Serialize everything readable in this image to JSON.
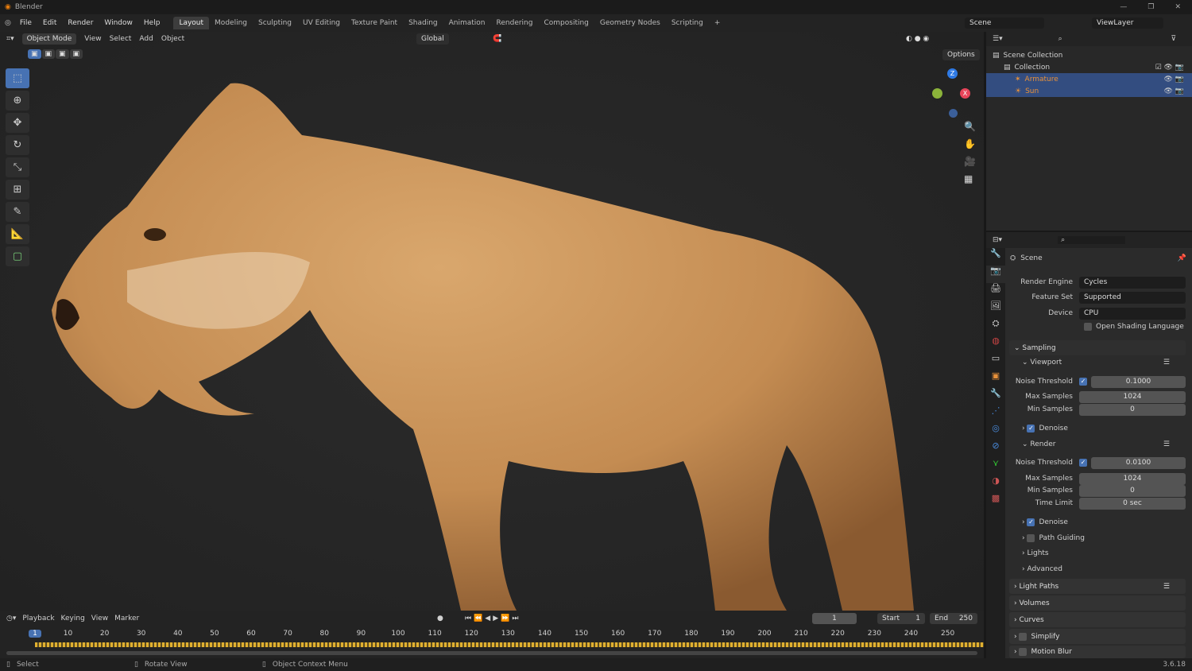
{
  "app": {
    "title": "Blender",
    "version": "3.6.18"
  },
  "menu": [
    "File",
    "Edit",
    "Render",
    "Window",
    "Help"
  ],
  "workspaces": [
    "Layout",
    "Modeling",
    "Sculpting",
    "UV Editing",
    "Texture Paint",
    "Shading",
    "Animation",
    "Rendering",
    "Compositing",
    "Geometry Nodes",
    "Scripting"
  ],
  "active_workspace": "Layout",
  "scene_name": "Scene",
  "view_layer": "ViewLayer",
  "viewport": {
    "mode": "Object Mode",
    "menus": [
      "View",
      "Select",
      "Add",
      "Object"
    ],
    "orientation": "Global",
    "options": "Options",
    "gizmo": {
      "z": "Z",
      "x": "X"
    }
  },
  "outliner": {
    "items": [
      {
        "label": "Scene Collection"
      },
      {
        "label": "Collection"
      },
      {
        "label": "Armature",
        "color": "#e8913a"
      },
      {
        "label": "Sun",
        "color": "#e8913a"
      }
    ]
  },
  "properties": {
    "header": "Scene",
    "render_engine_label": "Render Engine",
    "render_engine": "Cycles",
    "feature_set_label": "Feature Set",
    "feature_set": "Supported",
    "device_label": "Device",
    "device": "CPU",
    "osl": "Open Shading Language",
    "sampling": "Sampling",
    "viewport": {
      "title": "Viewport",
      "noise_label": "Noise Threshold",
      "noise": "0.1000",
      "max_label": "Max Samples",
      "max": "1024",
      "min_label": "Min Samples",
      "min": "0",
      "denoise": "Denoise"
    },
    "render": {
      "title": "Render",
      "noise_label": "Noise Threshold",
      "noise": "0.0100",
      "max_label": "Max Samples",
      "max": "1024",
      "min_label": "Min Samples",
      "min": "0",
      "time_label": "Time Limit",
      "time": "0 sec",
      "denoise": "Denoise",
      "path_guiding": "Path Guiding",
      "lights": "Lights",
      "advanced": "Advanced"
    },
    "sections": [
      "Light Paths",
      "Volumes",
      "Curves",
      "Simplify",
      "Motion Blur"
    ]
  },
  "timeline": {
    "menus": [
      "Playback",
      "Keying",
      "View",
      "Marker"
    ],
    "current_frame": "1",
    "start_label": "Start",
    "start": "1",
    "end_label": "End",
    "end": "250",
    "ticks": [
      "1",
      "10",
      "20",
      "30",
      "40",
      "50",
      "60",
      "70",
      "80",
      "90",
      "100",
      "110",
      "120",
      "130",
      "140",
      "150",
      "160",
      "170",
      "180",
      "190",
      "200",
      "210",
      "220",
      "230",
      "240",
      "250"
    ]
  },
  "status": [
    "Select",
    "Rotate View",
    "Object Context Menu"
  ],
  "colors": {
    "accent": "#4772b3",
    "selection": "#334d80",
    "fur": "#c9955c"
  }
}
